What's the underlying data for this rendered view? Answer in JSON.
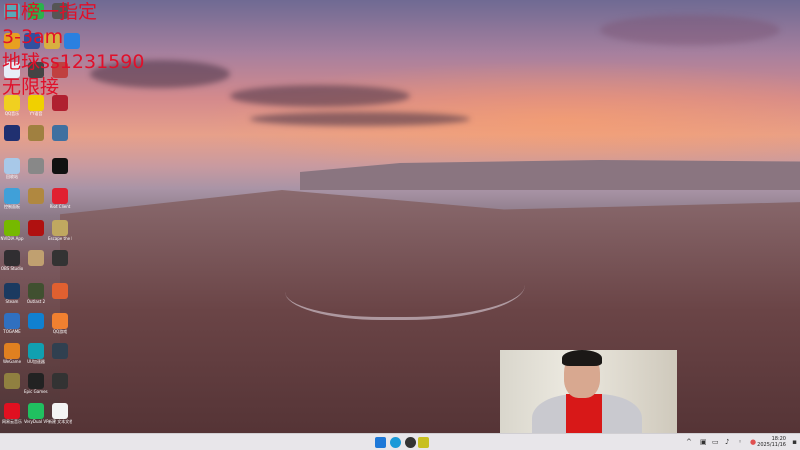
{
  "overlay_text": [
    "日榜一指定",
    "3-3am",
    "地球ss1231590",
    "无限接"
  ],
  "desktop_icons": [
    {
      "label": "",
      "color": "#5aa8b8"
    },
    {
      "label": "",
      "color": "#2bb24c"
    },
    {
      "label": "",
      "color": "#555"
    },
    {
      "label": "",
      "color": "#e8a020"
    },
    {
      "label": "",
      "color": "#3050a0"
    },
    {
      "label": "",
      "color": "#d8b040"
    },
    {
      "label": "",
      "color": "#2a80e0"
    },
    {
      "label": "",
      "color": "#e8eef8"
    },
    {
      "label": "",
      "color": "#444"
    },
    {
      "label": "",
      "color": "#c04040"
    },
    {
      "label": "QQ音乐",
      "color": "#f0d020"
    },
    {
      "label": "YY语音",
      "color": "#f0d000"
    },
    {
      "label": "",
      "color": "#b02030"
    },
    {
      "label": "",
      "color": "#203070"
    },
    {
      "label": "",
      "color": "#a08040"
    },
    {
      "label": "",
      "color": "#4070a0"
    },
    {
      "label": "回收站",
      "color": "#a8c8e8"
    },
    {
      "label": "",
      "color": "#888"
    },
    {
      "label": "",
      "color": "#111"
    },
    {
      "label": "控制面板",
      "color": "#40a0d8"
    },
    {
      "label": "",
      "color": "#b08840"
    },
    {
      "label": "Riot Client",
      "color": "#e02030"
    },
    {
      "label": "NVIDIA App",
      "color": "#76b900"
    },
    {
      "label": "",
      "color": "#b01010"
    },
    {
      "label": "Escape the Backrooms",
      "color": "#c0a860"
    },
    {
      "label": "OBS Studio",
      "color": "#302e31"
    },
    {
      "label": "",
      "color": "#c0a070"
    },
    {
      "label": "",
      "color": "#333"
    },
    {
      "label": "Steam",
      "color": "#1b3a60"
    },
    {
      "label": "Outlast 2",
      "color": "#405030"
    },
    {
      "label": "",
      "color": "#e06030"
    },
    {
      "label": "TOGAME",
      "color": "#3070c0"
    },
    {
      "label": "",
      "color": "#1080d0"
    },
    {
      "label": "QQ游戏",
      "color": "#f08030"
    },
    {
      "label": "WeGame",
      "color": "#e08020"
    },
    {
      "label": "UU加速器",
      "color": "#10a0b0"
    },
    {
      "label": "",
      "color": "#304050"
    },
    {
      "label": "",
      "color": "#908040"
    },
    {
      "label": "Epic Games Launcher",
      "color": "#222"
    },
    {
      "label": "",
      "color": "#333"
    },
    {
      "label": "网易云音乐",
      "color": "#e01020"
    },
    {
      "label": "VeryDual VR",
      "color": "#20c060"
    },
    {
      "label": "新建 文本文档",
      "color": "#f4f4f4"
    }
  ],
  "taskbar": {
    "apps": [
      {
        "name": "start",
        "color": "#1e78d8"
      },
      {
        "name": "edge",
        "color": "#1a9ad8"
      },
      {
        "name": "app",
        "color": "#333"
      },
      {
        "name": "app2",
        "color": "#c8c020"
      }
    ],
    "tray_chevron": "^",
    "time": "18:20",
    "date": "2025/11/16"
  }
}
